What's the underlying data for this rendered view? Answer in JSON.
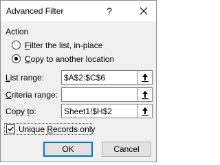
{
  "window": {
    "title": "Advanced Filter",
    "help_glyph": "?",
    "close_icon": "close-icon"
  },
  "action": {
    "label": "Action",
    "options": [
      {
        "mnemonic": "F",
        "rest": "ilter the list, in-place",
        "selected": false
      },
      {
        "mnemonic": "",
        "prefix": "",
        "text_before": "",
        "pre": "",
        "label_pre": "",
        "start": "",
        "full": "",
        "mn_index": 0,
        "pre_text": "",
        "a": "",
        "b": "",
        "p1": "",
        "p2": "",
        "display_pre": "",
        "display_m": "C",
        "display_rest": "opy to another location",
        "selected": true
      }
    ]
  },
  "fields": {
    "list_range": {
      "label_m": "L",
      "label_rest": "ist range:",
      "value": "$A$2:$C$6"
    },
    "criteria_range": {
      "label_m": "C",
      "label_rest": "riteria range:",
      "value": ""
    },
    "copy_to": {
      "label_pre": "Copy ",
      "label_m": "t",
      "label_rest": "o:",
      "value": "Sheet1!$H$2"
    }
  },
  "unique": {
    "label_m": "R",
    "label_pre": "Unique ",
    "label_rest": "ecords only",
    "checked": true
  },
  "buttons": {
    "ok": "OK",
    "cancel": "Cancel"
  },
  "colors": {
    "accent": "#0078d7",
    "dialog_bg": "#f0f0f0"
  }
}
